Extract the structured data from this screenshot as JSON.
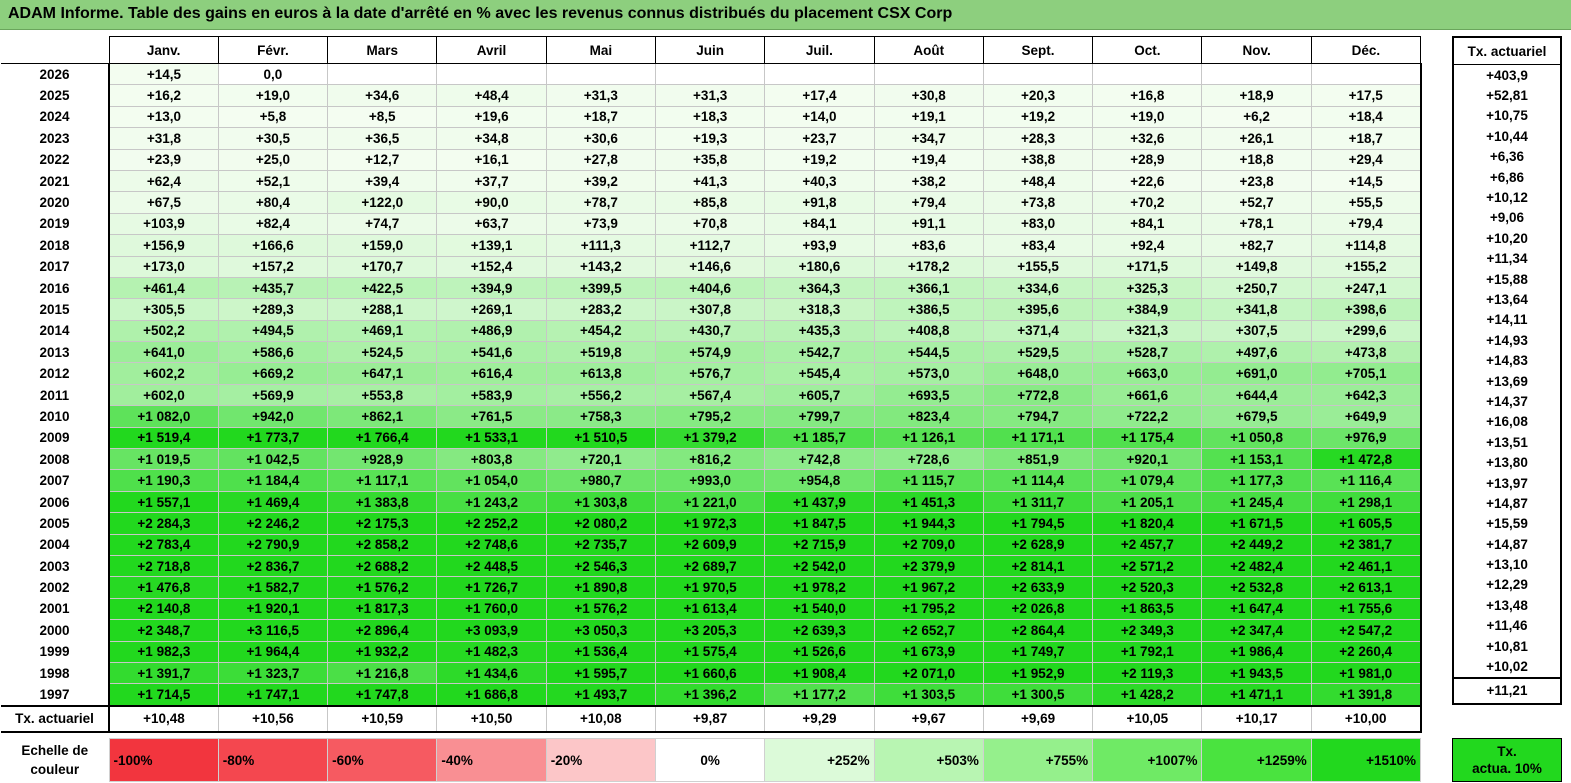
{
  "title": "ADAM Informe. Table des gains en euros à la date d'arrêté en % avec les revenus connus distribués du placement CSX Corp",
  "months": [
    "Janv.",
    "Févr.",
    "Mars",
    "Avril",
    "Mai",
    "Juin",
    "Juil.",
    "Août",
    "Sept.",
    "Oct.",
    "Nov.",
    "Déc."
  ],
  "side_header": "Tx. actuariel",
  "rows": [
    {
      "year": "2026",
      "vals": [
        "+14,5",
        "0,0",
        "",
        "",
        "",
        "",
        "",
        "",
        "",
        "",
        "",
        ""
      ],
      "tx": "+403,9"
    },
    {
      "year": "2025",
      "vals": [
        "+16,2",
        "+19,0",
        "+34,6",
        "+48,4",
        "+31,3",
        "+31,3",
        "+17,4",
        "+30,8",
        "+20,3",
        "+16,8",
        "+18,9",
        "+17,5"
      ],
      "tx": "+52,81"
    },
    {
      "year": "2024",
      "vals": [
        "+13,0",
        "+5,8",
        "+8,5",
        "+19,6",
        "+18,7",
        "+18,3",
        "+14,0",
        "+19,1",
        "+19,2",
        "+19,0",
        "+6,2",
        "+18,4"
      ],
      "tx": "+10,75"
    },
    {
      "year": "2023",
      "vals": [
        "+31,8",
        "+30,5",
        "+36,5",
        "+34,8",
        "+30,6",
        "+19,3",
        "+23,7",
        "+34,7",
        "+28,3",
        "+32,6",
        "+26,1",
        "+18,7"
      ],
      "tx": "+10,44"
    },
    {
      "year": "2022",
      "vals": [
        "+23,9",
        "+25,0",
        "+12,7",
        "+16,1",
        "+27,8",
        "+35,8",
        "+19,2",
        "+19,4",
        "+38,8",
        "+28,9",
        "+18,8",
        "+29,4"
      ],
      "tx": "+6,36"
    },
    {
      "year": "2021",
      "vals": [
        "+62,4",
        "+52,1",
        "+39,4",
        "+37,7",
        "+39,2",
        "+41,3",
        "+40,3",
        "+38,2",
        "+48,4",
        "+22,6",
        "+23,8",
        "+14,5"
      ],
      "tx": "+6,86"
    },
    {
      "year": "2020",
      "vals": [
        "+67,5",
        "+80,4",
        "+122,0",
        "+90,0",
        "+78,7",
        "+85,8",
        "+91,8",
        "+79,4",
        "+73,8",
        "+70,2",
        "+52,7",
        "+55,5"
      ],
      "tx": "+10,12"
    },
    {
      "year": "2019",
      "vals": [
        "+103,9",
        "+82,4",
        "+74,7",
        "+63,7",
        "+73,9",
        "+70,8",
        "+84,1",
        "+91,1",
        "+83,0",
        "+84,1",
        "+78,1",
        "+79,4"
      ],
      "tx": "+9,06"
    },
    {
      "year": "2018",
      "vals": [
        "+156,9",
        "+166,6",
        "+159,0",
        "+139,1",
        "+111,3",
        "+112,7",
        "+93,9",
        "+83,6",
        "+83,4",
        "+92,4",
        "+82,7",
        "+114,8"
      ],
      "tx": "+10,20"
    },
    {
      "year": "2017",
      "vals": [
        "+173,0",
        "+157,2",
        "+170,7",
        "+152,4",
        "+143,2",
        "+146,6",
        "+180,6",
        "+178,2",
        "+155,5",
        "+171,5",
        "+149,8",
        "+155,2"
      ],
      "tx": "+11,34"
    },
    {
      "year": "2016",
      "vals": [
        "+461,4",
        "+435,7",
        "+422,5",
        "+394,9",
        "+399,5",
        "+404,6",
        "+364,3",
        "+366,1",
        "+334,6",
        "+325,3",
        "+250,7",
        "+247,1"
      ],
      "tx": "+15,88"
    },
    {
      "year": "2015",
      "vals": [
        "+305,5",
        "+289,3",
        "+288,1",
        "+269,1",
        "+283,2",
        "+307,8",
        "+318,3",
        "+386,5",
        "+395,6",
        "+384,9",
        "+341,8",
        "+398,6"
      ],
      "tx": "+13,64"
    },
    {
      "year": "2014",
      "vals": [
        "+502,2",
        "+494,5",
        "+469,1",
        "+486,9",
        "+454,2",
        "+430,7",
        "+435,3",
        "+408,8",
        "+371,4",
        "+321,3",
        "+307,5",
        "+299,6"
      ],
      "tx": "+14,11"
    },
    {
      "year": "2013",
      "vals": [
        "+641,0",
        "+586,6",
        "+524,5",
        "+541,6",
        "+519,8",
        "+574,9",
        "+542,7",
        "+544,5",
        "+529,5",
        "+528,7",
        "+497,6",
        "+473,8"
      ],
      "tx": "+14,93"
    },
    {
      "year": "2012",
      "vals": [
        "+602,2",
        "+669,2",
        "+647,1",
        "+616,4",
        "+613,8",
        "+576,7",
        "+545,4",
        "+573,0",
        "+648,0",
        "+663,0",
        "+691,0",
        "+705,1"
      ],
      "tx": "+14,83"
    },
    {
      "year": "2011",
      "vals": [
        "+602,0",
        "+569,9",
        "+553,8",
        "+583,9",
        "+556,2",
        "+567,4",
        "+605,7",
        "+693,5",
        "+772,8",
        "+661,6",
        "+644,4",
        "+642,3"
      ],
      "tx": "+13,69"
    },
    {
      "year": "2010",
      "vals": [
        "+1 082,0",
        "+942,0",
        "+862,1",
        "+761,5",
        "+758,3",
        "+795,2",
        "+799,7",
        "+823,4",
        "+794,7",
        "+722,2",
        "+679,5",
        "+649,9"
      ],
      "tx": "+14,37"
    },
    {
      "year": "2009",
      "vals": [
        "+1 519,4",
        "+1 773,7",
        "+1 766,4",
        "+1 533,1",
        "+1 510,5",
        "+1 379,2",
        "+1 185,7",
        "+1 126,1",
        "+1 171,1",
        "+1 175,4",
        "+1 050,8",
        "+976,9"
      ],
      "tx": "+16,08"
    },
    {
      "year": "2008",
      "vals": [
        "+1 019,5",
        "+1 042,5",
        "+928,9",
        "+803,8",
        "+720,1",
        "+816,2",
        "+742,8",
        "+728,6",
        "+851,9",
        "+920,1",
        "+1 153,1",
        "+1 472,8"
      ],
      "tx": "+13,51"
    },
    {
      "year": "2007",
      "vals": [
        "+1 190,3",
        "+1 184,4",
        "+1 117,1",
        "+1 054,0",
        "+980,7",
        "+993,0",
        "+954,8",
        "+1 115,7",
        "+1 114,4",
        "+1 079,4",
        "+1 177,3",
        "+1 116,4"
      ],
      "tx": "+13,80"
    },
    {
      "year": "2006",
      "vals": [
        "+1 557,1",
        "+1 469,4",
        "+1 383,8",
        "+1 243,2",
        "+1 303,8",
        "+1 221,0",
        "+1 437,9",
        "+1 451,3",
        "+1 311,7",
        "+1 205,1",
        "+1 245,4",
        "+1 298,1"
      ],
      "tx": "+13,97"
    },
    {
      "year": "2005",
      "vals": [
        "+2 284,3",
        "+2 246,2",
        "+2 175,3",
        "+2 252,2",
        "+2 080,2",
        "+1 972,3",
        "+1 847,5",
        "+1 944,3",
        "+1 794,5",
        "+1 820,4",
        "+1 671,5",
        "+1 605,5"
      ],
      "tx": "+14,87"
    },
    {
      "year": "2004",
      "vals": [
        "+2 783,4",
        "+2 790,9",
        "+2 858,2",
        "+2 748,6",
        "+2 735,7",
        "+2 609,9",
        "+2 715,9",
        "+2 709,0",
        "+2 628,9",
        "+2 457,7",
        "+2 449,2",
        "+2 381,7"
      ],
      "tx": "+15,59"
    },
    {
      "year": "2003",
      "vals": [
        "+2 718,8",
        "+2 836,7",
        "+2 688,2",
        "+2 448,5",
        "+2 546,3",
        "+2 689,7",
        "+2 542,0",
        "+2 379,9",
        "+2 814,1",
        "+2 571,2",
        "+2 482,4",
        "+2 461,1"
      ],
      "tx": "+14,87"
    },
    {
      "year": "2002",
      "vals": [
        "+1 476,8",
        "+1 582,7",
        "+1 576,2",
        "+1 726,7",
        "+1 890,8",
        "+1 970,5",
        "+1 978,2",
        "+1 967,2",
        "+2 633,9",
        "+2 520,3",
        "+2 532,8",
        "+2 613,1"
      ],
      "tx": "+13,10"
    },
    {
      "year": "2001",
      "vals": [
        "+2 140,8",
        "+1 920,1",
        "+1 817,3",
        "+1 760,0",
        "+1 576,2",
        "+1 613,4",
        "+1 540,0",
        "+1 795,2",
        "+2 026,8",
        "+1 863,5",
        "+1 647,4",
        "+1 755,6"
      ],
      "tx": "+12,29"
    },
    {
      "year": "2000",
      "vals": [
        "+2 348,7",
        "+3 116,5",
        "+2 896,4",
        "+3 093,9",
        "+3 050,3",
        "+3 205,3",
        "+2 639,3",
        "+2 652,7",
        "+2 864,4",
        "+2 349,3",
        "+2 347,4",
        "+2 547,2"
      ],
      "tx": "+13,48"
    },
    {
      "year": "1999",
      "vals": [
        "+1 982,3",
        "+1 964,4",
        "+1 932,2",
        "+1 482,3",
        "+1 536,4",
        "+1 575,4",
        "+1 526,6",
        "+1 673,9",
        "+1 749,7",
        "+1 792,1",
        "+1 986,4",
        "+2 260,4"
      ],
      "tx": "+11,46"
    },
    {
      "year": "1998",
      "vals": [
        "+1 391,7",
        "+1 323,7",
        "+1 216,8",
        "+1 434,6",
        "+1 595,7",
        "+1 660,6",
        "+1 908,4",
        "+2 071,0",
        "+1 952,9",
        "+2 119,3",
        "+1 943,5",
        "+1 981,0"
      ],
      "tx": "+10,81"
    },
    {
      "year": "1997",
      "vals": [
        "+1 714,5",
        "+1 747,1",
        "+1 747,8",
        "+1 686,8",
        "+1 493,7",
        "+1 396,2",
        "+1 177,2",
        "+1 303,5",
        "+1 300,5",
        "+1 428,2",
        "+1 471,1",
        "+1 391,8"
      ],
      "tx": "+10,02"
    }
  ],
  "summary": {
    "label": "Tx. actuariel",
    "vals": [
      "+10,48",
      "+10,56",
      "+10,59",
      "+10,50",
      "+10,08",
      "+9,87",
      "+9,29",
      "+9,67",
      "+9,69",
      "+10,05",
      "+10,17",
      "+10,00"
    ],
    "tx": "+11,21"
  },
  "scale": {
    "label_line1": "Echelle de",
    "label_line2": "couleur",
    "steps": [
      {
        "text": "-100%",
        "color": "#f2353e"
      },
      {
        "text": "-80%",
        "color": "#f4474f"
      },
      {
        "text": "-60%",
        "color": "#f65a61"
      },
      {
        "text": "-40%",
        "color": "#f98f93"
      },
      {
        "text": "-20%",
        "color": "#fcc6c8"
      },
      {
        "text": "0%",
        "color": "#ffffff"
      },
      {
        "text": "+252%",
        "color": "#dcfad9"
      },
      {
        "text": "+503%",
        "color": "#b8f5b2"
      },
      {
        "text": "+755%",
        "color": "#95f08c"
      },
      {
        "text": "+1007%",
        "color": "#6fea65"
      },
      {
        "text": "+1259%",
        "color": "#4ae33f"
      },
      {
        "text": "+1510%",
        "color": "#22d81e"
      }
    ],
    "side_line1": "Tx.",
    "side_line2": "actua. 10%"
  },
  "colors": {
    "title_bg": "#8dcf7e",
    "max_green": "#22d81e"
  }
}
